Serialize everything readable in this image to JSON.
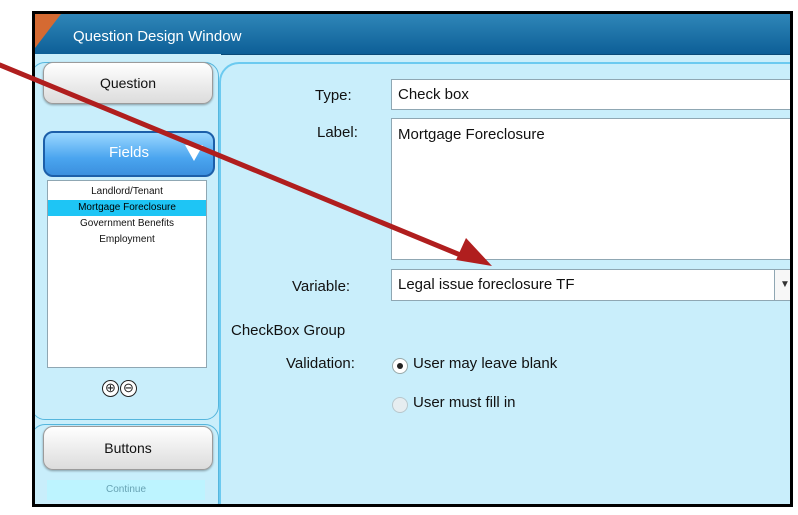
{
  "window": {
    "title": "Question Design Window"
  },
  "left_panel": {
    "question_button": "Question",
    "fields_button": "Fields",
    "fields_list": [
      {
        "label": "Landlord/Tenant",
        "selected": false
      },
      {
        "label": "Mortgage Foreclosure",
        "selected": true
      },
      {
        "label": "Government Benefits",
        "selected": false
      },
      {
        "label": "Employment",
        "selected": false
      }
    ],
    "add_icon": "⊕",
    "remove_icon": "⊖",
    "buttons_button": "Buttons",
    "buttons_list": [
      "Continue"
    ]
  },
  "form": {
    "type_label": "Type:",
    "type_value": "Check box",
    "label_label": "Label:",
    "label_value": "Mortgage Foreclosure",
    "variable_label": "Variable:",
    "variable_value": "Legal issue foreclosure TF",
    "group_heading": "CheckBox Group",
    "validation_label": "Validation:",
    "validation_options": [
      {
        "label": "User may leave blank",
        "selected": true
      },
      {
        "label": "User must fill in",
        "selected": false
      }
    ]
  },
  "colors": {
    "accent": "#2f86b8",
    "arrow": "#b01e1e",
    "selected_row": "#1ec5f5",
    "panel_bg": "#c9eefb"
  }
}
